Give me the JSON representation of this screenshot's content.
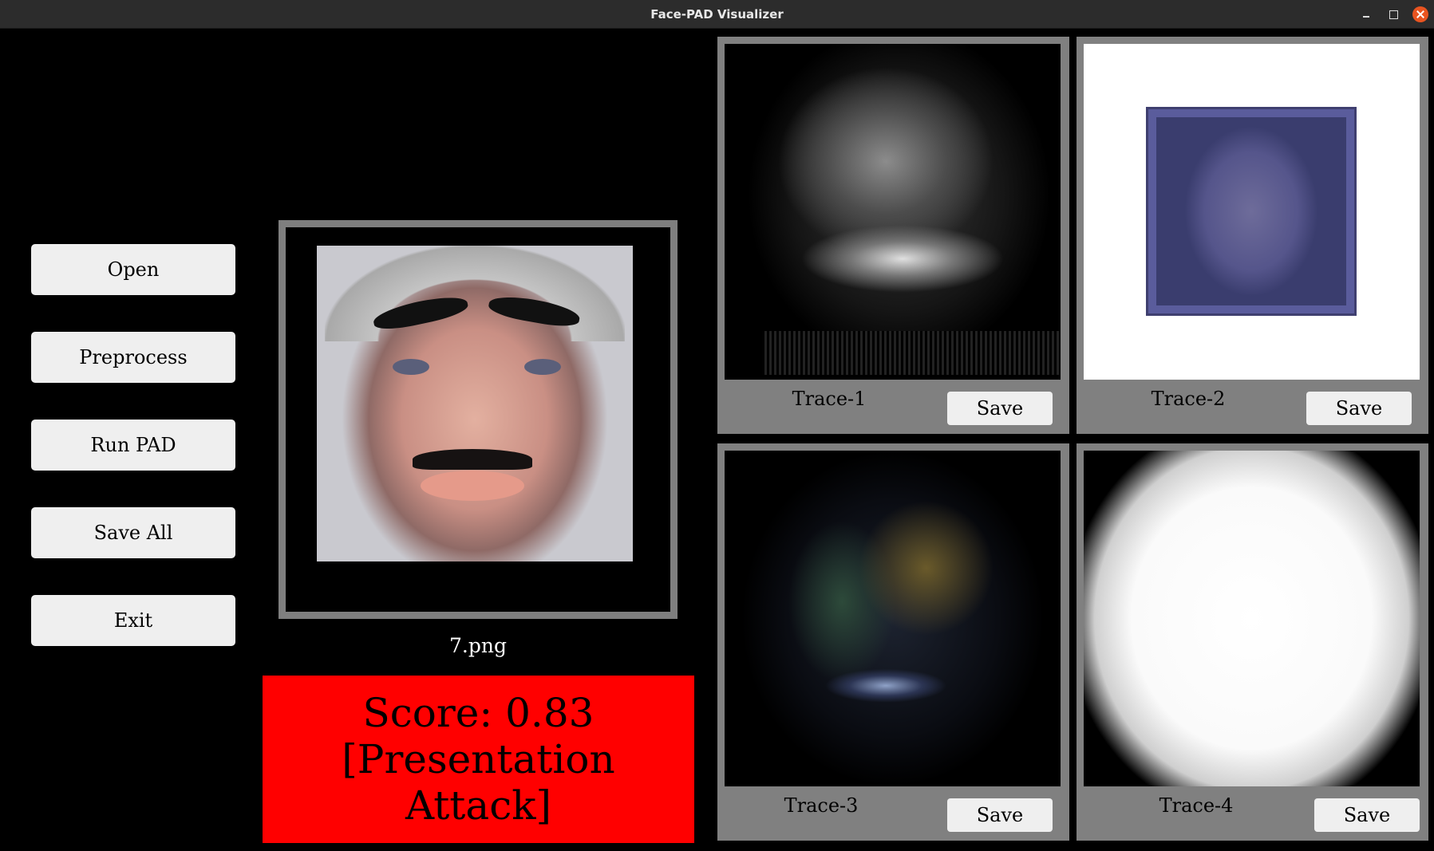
{
  "window": {
    "title": "Face-PAD Visualizer"
  },
  "sidebar": {
    "buttons": [
      {
        "label": "Open"
      },
      {
        "label": "Preprocess"
      },
      {
        "label": "Run PAD"
      },
      {
        "label": "Save All"
      },
      {
        "label": "Exit"
      }
    ]
  },
  "main": {
    "filename": "7.png",
    "score_line": "Score: 0.83",
    "verdict_line": "[Presentation Attack]",
    "score_color": "#ff0000"
  },
  "traces": [
    {
      "label": "Trace-1",
      "save_label": "Save"
    },
    {
      "label": "Trace-2",
      "save_label": "Save"
    },
    {
      "label": "Trace-3",
      "save_label": "Save"
    },
    {
      "label": "Trace-4",
      "save_label": "Save"
    }
  ]
}
